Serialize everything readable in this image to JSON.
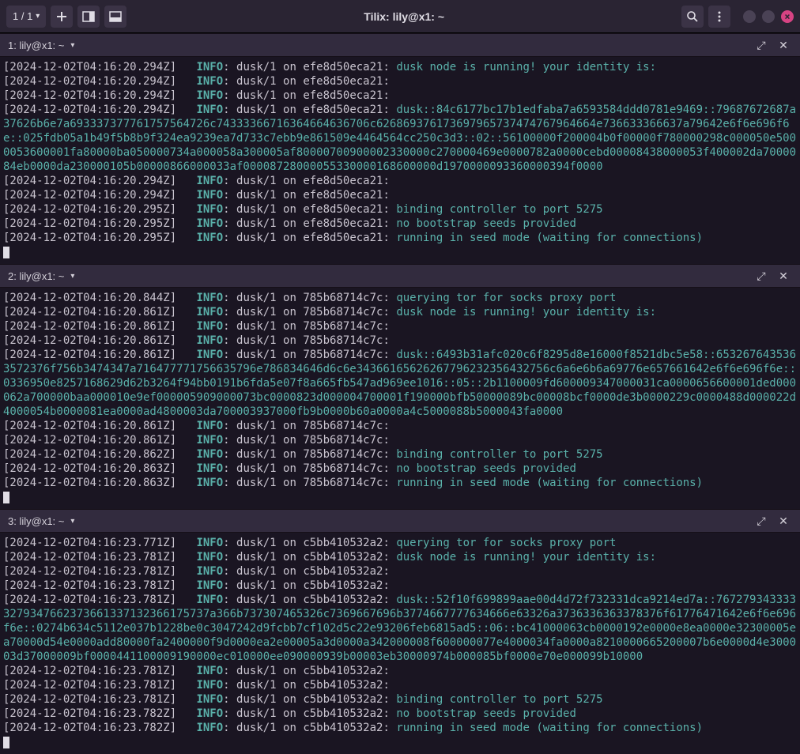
{
  "titlebar": {
    "page_indicator": "1 / 1",
    "title": "Tilix: lily@x1: ~"
  },
  "panes": [
    {
      "title": "1: lily@x1: ~",
      "lines": [
        {
          "ts": "[2024-12-02T04:16:20.294Z]",
          "lvl": "INFO",
          "ctx": ": dusk/1 on efe8d50eca21:",
          "msg": " dusk node is running! your identity is:"
        },
        {
          "ts": "[2024-12-02T04:16:20.294Z]",
          "lvl": "INFO",
          "ctx": ": dusk/1 on efe8d50eca21:",
          "msg": ""
        },
        {
          "ts": "[2024-12-02T04:16:20.294Z]",
          "lvl": "INFO",
          "ctx": ": dusk/1 on efe8d50eca21:",
          "msg": ""
        },
        {
          "ts": "[2024-12-02T04:16:20.294Z]",
          "lvl": "INFO",
          "ctx": ": dusk/1 on efe8d50eca21:",
          "msg": " dusk::84c6177bc17b1edfaba7a6593584ddd0781e9469::79687672687a37626b6e7a693337377761757564726c74333366716364664636706c626869376173697965737474767964664e736633366637a79642e6f6e696f6e::025fdb05a1b49f5b8b9f324ea9239ea7d733c7ebb9e861509e4464564cc250c3d3::02::56100000f200004b0f00000f780000298c000050e5000053600001fa80000ba050000734a000058a300005af80000700900002330000c270000469e0000782a0000cebd00008438000053f400002da7000084eb0000da230000105b00000866000033af00008728000055330000168600000d1970000093360000394f0000"
        },
        {
          "ts": "[2024-12-02T04:16:20.294Z]",
          "lvl": "INFO",
          "ctx": ": dusk/1 on efe8d50eca21:",
          "msg": ""
        },
        {
          "ts": "[2024-12-02T04:16:20.294Z]",
          "lvl": "INFO",
          "ctx": ": dusk/1 on efe8d50eca21:",
          "msg": ""
        },
        {
          "ts": "[2024-12-02T04:16:20.295Z]",
          "lvl": "INFO",
          "ctx": ": dusk/1 on efe8d50eca21:",
          "msg": " binding controller to port 5275"
        },
        {
          "ts": "[2024-12-02T04:16:20.295Z]",
          "lvl": "INFO",
          "ctx": ": dusk/1 on efe8d50eca21:",
          "msg": " no bootstrap seeds provided"
        },
        {
          "ts": "[2024-12-02T04:16:20.295Z]",
          "lvl": "INFO",
          "ctx": ": dusk/1 on efe8d50eca21:",
          "msg": " running in seed mode (waiting for connections)"
        }
      ]
    },
    {
      "title": "2: lily@x1: ~",
      "lines": [
        {
          "ts": "[2024-12-02T04:16:20.844Z]",
          "lvl": "INFO",
          "ctx": ": dusk/1 on 785b68714c7c:",
          "msg": " querying tor for socks proxy port"
        },
        {
          "ts": "[2024-12-02T04:16:20.861Z]",
          "lvl": "INFO",
          "ctx": ": dusk/1 on 785b68714c7c:",
          "msg": " dusk node is running! your identity is:"
        },
        {
          "ts": "[2024-12-02T04:16:20.861Z]",
          "lvl": "INFO",
          "ctx": ": dusk/1 on 785b68714c7c:",
          "msg": ""
        },
        {
          "ts": "[2024-12-02T04:16:20.861Z]",
          "lvl": "INFO",
          "ctx": ": dusk/1 on 785b68714c7c:",
          "msg": ""
        },
        {
          "ts": "[2024-12-02T04:16:20.861Z]",
          "lvl": "INFO",
          "ctx": ": dusk/1 on 785b68714c7c:",
          "msg": " dusk::6493b31afc020c6f8295d8e16000f8521dbc5e58::6532676435363572376f756b3474347a716477771756635796e786834646d6c6e34366165626267796232356432756c6a6e6b6a69776e657661642e6f6e696f6e::0336950e8257168629d62b3264f94bb0191b6fda5e07f8a665fb547ad969ee1016::05::2b1100009fd600009347000031ca0000656600001ded000062a700000baa000010e9ef000005909000073bc0000823d000004700001f190000bfb50000089bc00008bcf0000de3b0000229c0000488d000022d4000054b0000081ea0000ad4800003da700003937000fb9b0000b60a0000a4c5000088b5000043fa0000"
        },
        {
          "ts": "[2024-12-02T04:16:20.861Z]",
          "lvl": "INFO",
          "ctx": ": dusk/1 on 785b68714c7c:",
          "msg": ""
        },
        {
          "ts": "[2024-12-02T04:16:20.861Z]",
          "lvl": "INFO",
          "ctx": ": dusk/1 on 785b68714c7c:",
          "msg": ""
        },
        {
          "ts": "[2024-12-02T04:16:20.862Z]",
          "lvl": "INFO",
          "ctx": ": dusk/1 on 785b68714c7c:",
          "msg": " binding controller to port 5275"
        },
        {
          "ts": "[2024-12-02T04:16:20.863Z]",
          "lvl": "INFO",
          "ctx": ": dusk/1 on 785b68714c7c:",
          "msg": " no bootstrap seeds provided"
        },
        {
          "ts": "[2024-12-02T04:16:20.863Z]",
          "lvl": "INFO",
          "ctx": ": dusk/1 on 785b68714c7c:",
          "msg": " running in seed mode (waiting for connections)"
        }
      ]
    },
    {
      "title": "3: lily@x1: ~",
      "lines": [
        {
          "ts": "[2024-12-02T04:16:23.771Z]",
          "lvl": "INFO",
          "ctx": ": dusk/1 on c5bb410532a2:",
          "msg": " querying tor for socks proxy port"
        },
        {
          "ts": "[2024-12-02T04:16:23.781Z]",
          "lvl": "INFO",
          "ctx": ": dusk/1 on c5bb410532a2:",
          "msg": " dusk node is running! your identity is:"
        },
        {
          "ts": "[2024-12-02T04:16:23.781Z]",
          "lvl": "INFO",
          "ctx": ": dusk/1 on c5bb410532a2:",
          "msg": ""
        },
        {
          "ts": "[2024-12-02T04:16:23.781Z]",
          "lvl": "INFO",
          "ctx": ": dusk/1 on c5bb410532a2:",
          "msg": ""
        },
        {
          "ts": "[2024-12-02T04:16:23.781Z]",
          "lvl": "INFO",
          "ctx": ": dusk/1 on c5bb410532a2:",
          "msg": " dusk::52f10f699899aae00d4d72f732331dca9214ed7a::7672793433333279347662373661337132366175737a366b737307465326c7369667696b3774667777634666e63326a3736336363378376f61776471642e6f6e696f6e::0274b634c5112e037b1228be0c3047242d9fcbb7cf102d5c22e93206feb6815ad5::06::bc41000063cb0000192e0000e8ea0000e32300005ea70000d54e0000add80000fa2400000f9d0000ea2e00005a3d0000a342000008f600000077e4000034fa0000a8210000665200007b6e0000d4e300003d37000009bf0000441100009190000ec010000ee090000939b00003eb30000974b000085bf0000e70e000099b10000"
        },
        {
          "ts": "[2024-12-02T04:16:23.781Z]",
          "lvl": "INFO",
          "ctx": ": dusk/1 on c5bb410532a2:",
          "msg": ""
        },
        {
          "ts": "[2024-12-02T04:16:23.781Z]",
          "lvl": "INFO",
          "ctx": ": dusk/1 on c5bb410532a2:",
          "msg": ""
        },
        {
          "ts": "[2024-12-02T04:16:23.781Z]",
          "lvl": "INFO",
          "ctx": ": dusk/1 on c5bb410532a2:",
          "msg": " binding controller to port 5275"
        },
        {
          "ts": "[2024-12-02T04:16:23.782Z]",
          "lvl": "INFO",
          "ctx": ": dusk/1 on c5bb410532a2:",
          "msg": " no bootstrap seeds provided"
        },
        {
          "ts": "[2024-12-02T04:16:23.782Z]",
          "lvl": "INFO",
          "ctx": ": dusk/1 on c5bb410532a2:",
          "msg": " running in seed mode (waiting for connections)"
        }
      ]
    }
  ]
}
